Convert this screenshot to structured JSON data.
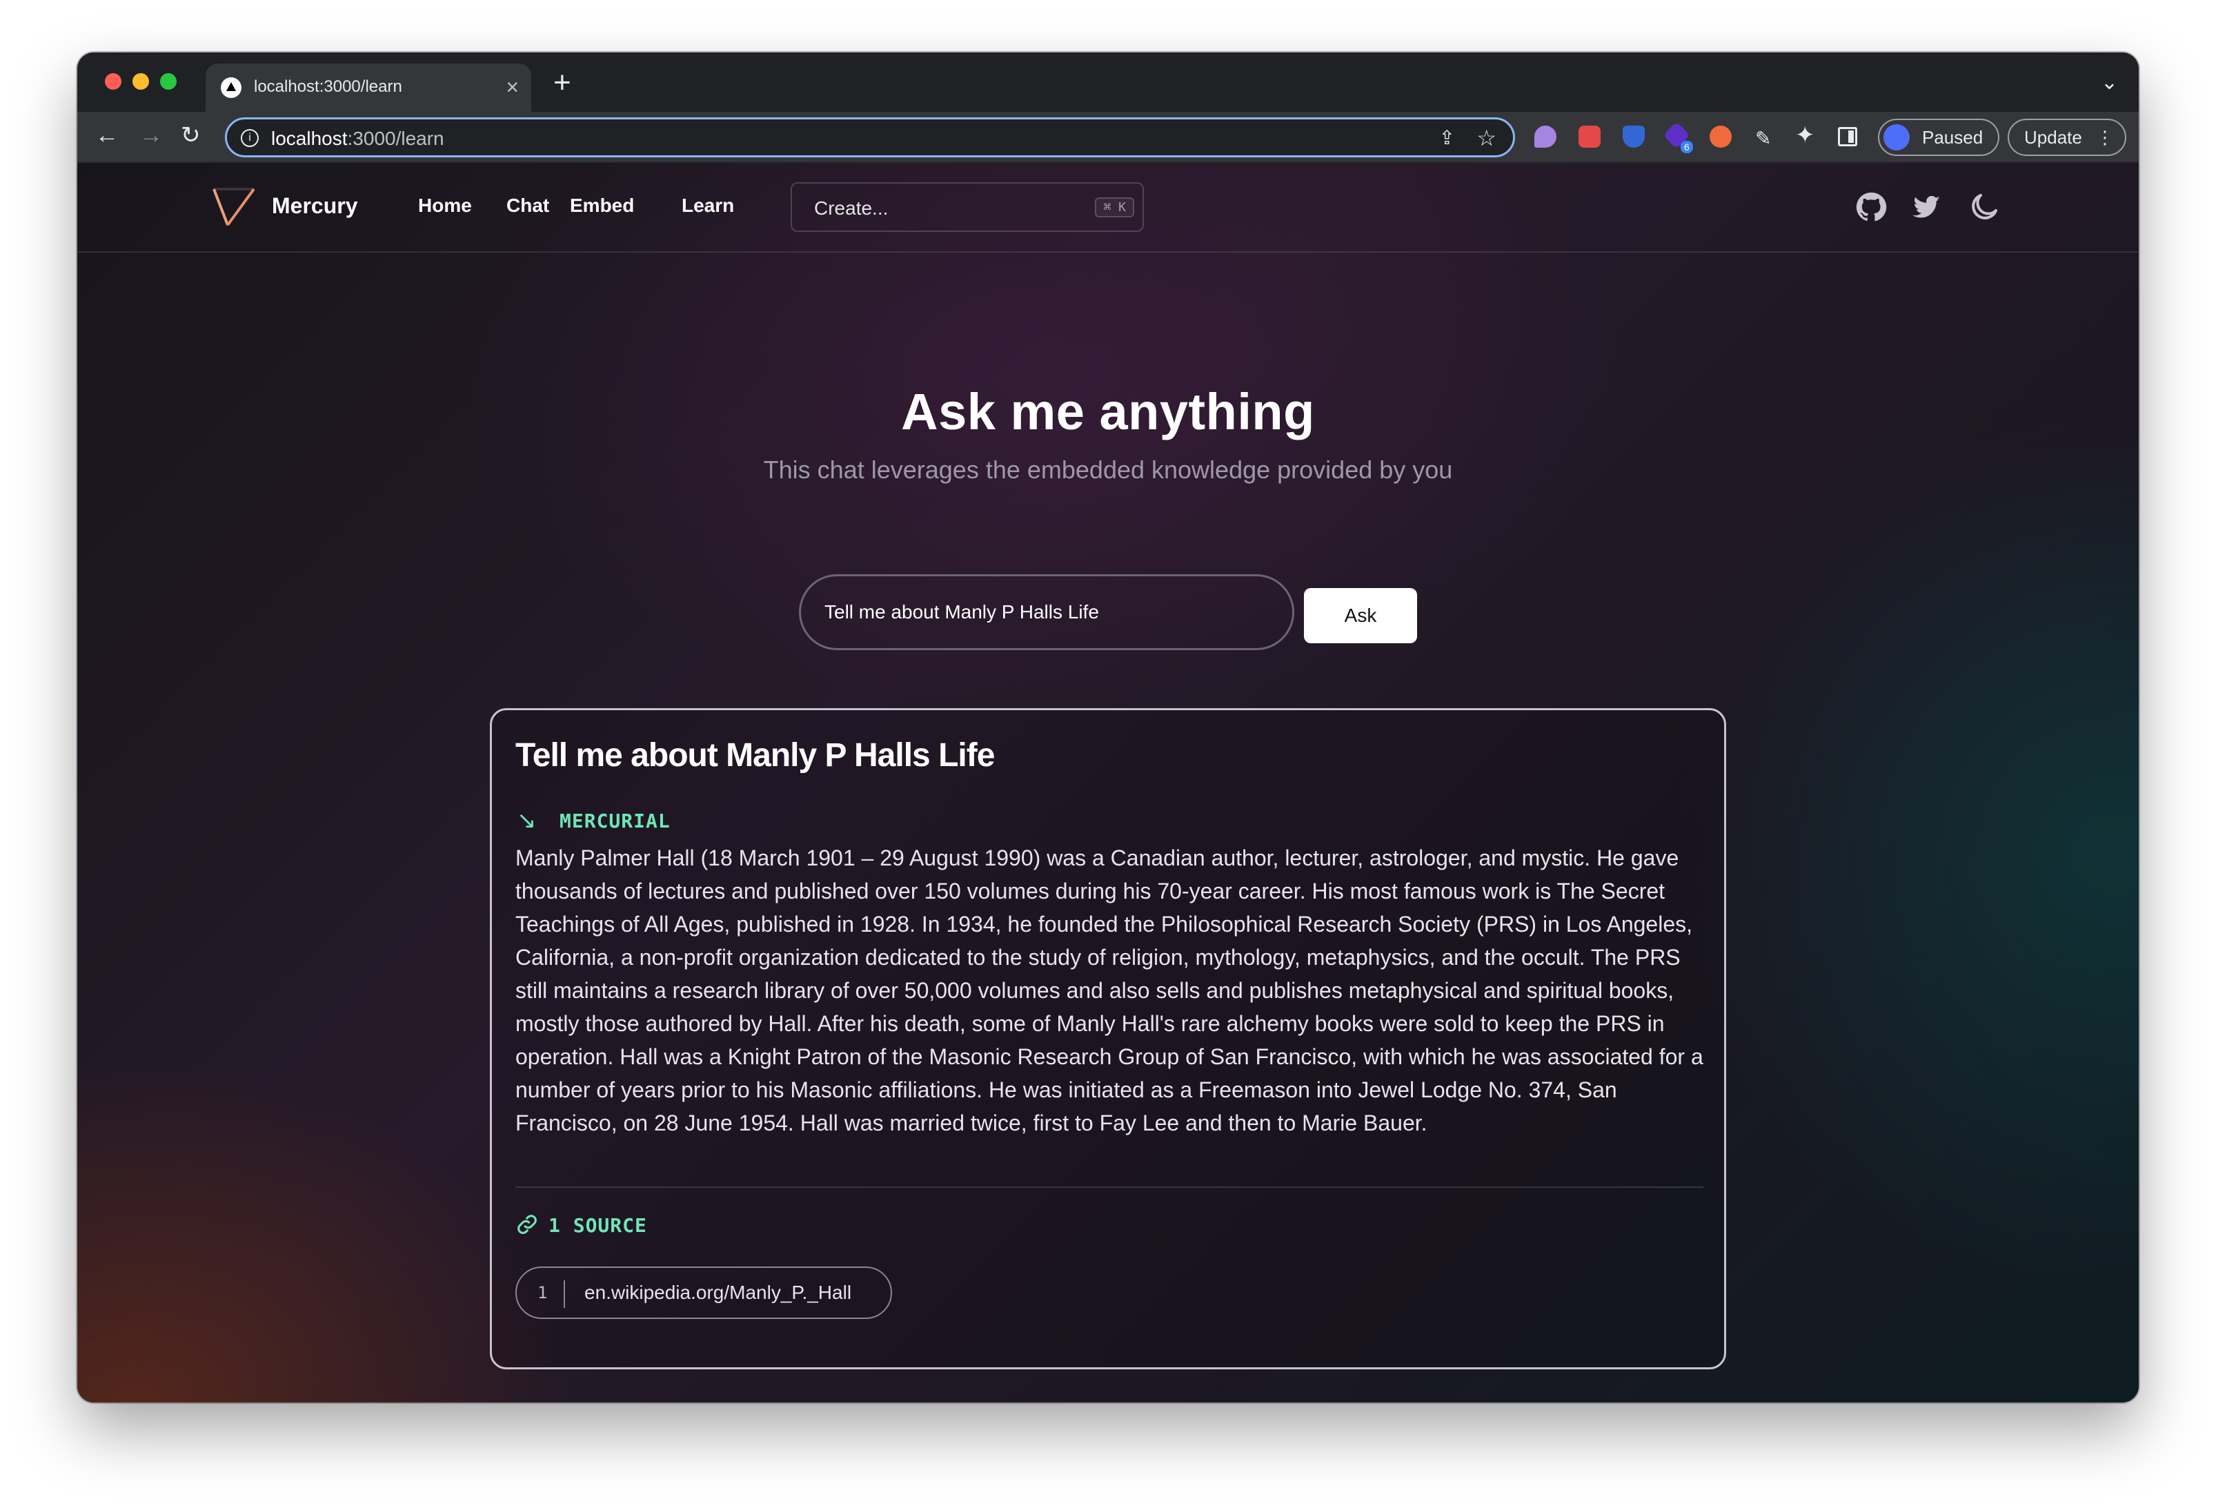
{
  "browser": {
    "tab_title": "localhost:3000/learn",
    "tab_close": "×",
    "new_tab": "+",
    "url_host": "localhost",
    "url_rest": ":3000/learn",
    "profile_status": "Paused",
    "update_label": "Update",
    "extension_badge": "6"
  },
  "nav": {
    "brand": "Mercury",
    "links": [
      "Home",
      "Chat",
      "Embed",
      "Learn"
    ],
    "create_placeholder": "Create...",
    "shortcut": "⌘ K"
  },
  "hero": {
    "title": "Ask me anything",
    "subtitle": "This chat leverages the embedded knowledge provided by you"
  },
  "ask": {
    "input_value": "Tell me about Manly P Halls Life",
    "button_label": "Ask"
  },
  "answer": {
    "title": "Tell me about Manly P Halls Life",
    "model": "MERCURIAL",
    "body": "Manly Palmer Hall (18 March 1901 – 29 August 1990) was a Canadian author, lecturer, astrologer, and mystic. He gave thousands of lectures and published over 150 volumes during his 70-year career. His most famous work is The Secret Teachings of All Ages, published in 1928. In 1934, he founded the Philosophical Research Society (PRS) in Los Angeles, California, a non-profit organization dedicated to the study of religion, mythology, metaphysics, and the occult. The PRS still maintains a research library of over 50,000 volumes and also sells and publishes metaphysical and spiritual books, mostly those authored by Hall. After his death, some of Manly Hall's rare alchemy books were sold to keep the PRS in operation. Hall was a Knight Patron of the Masonic Research Group of San Francisco, with which he was associated for a number of years prior to his Masonic affiliations. He was initiated as a Freemason into Jewel Lodge No. 374, San Francisco, on 28 June 1954. Hall was married twice, first to Fay Lee and then to Marie Bauer.",
    "sources_label": "1 SOURCE",
    "sources": [
      {
        "num": "1",
        "url": "en.wikipedia.org/Manly_P._Hall"
      }
    ]
  },
  "colors": {
    "accent": "#6ee7b7",
    "omnibox_focus": "#8ab4f8"
  }
}
